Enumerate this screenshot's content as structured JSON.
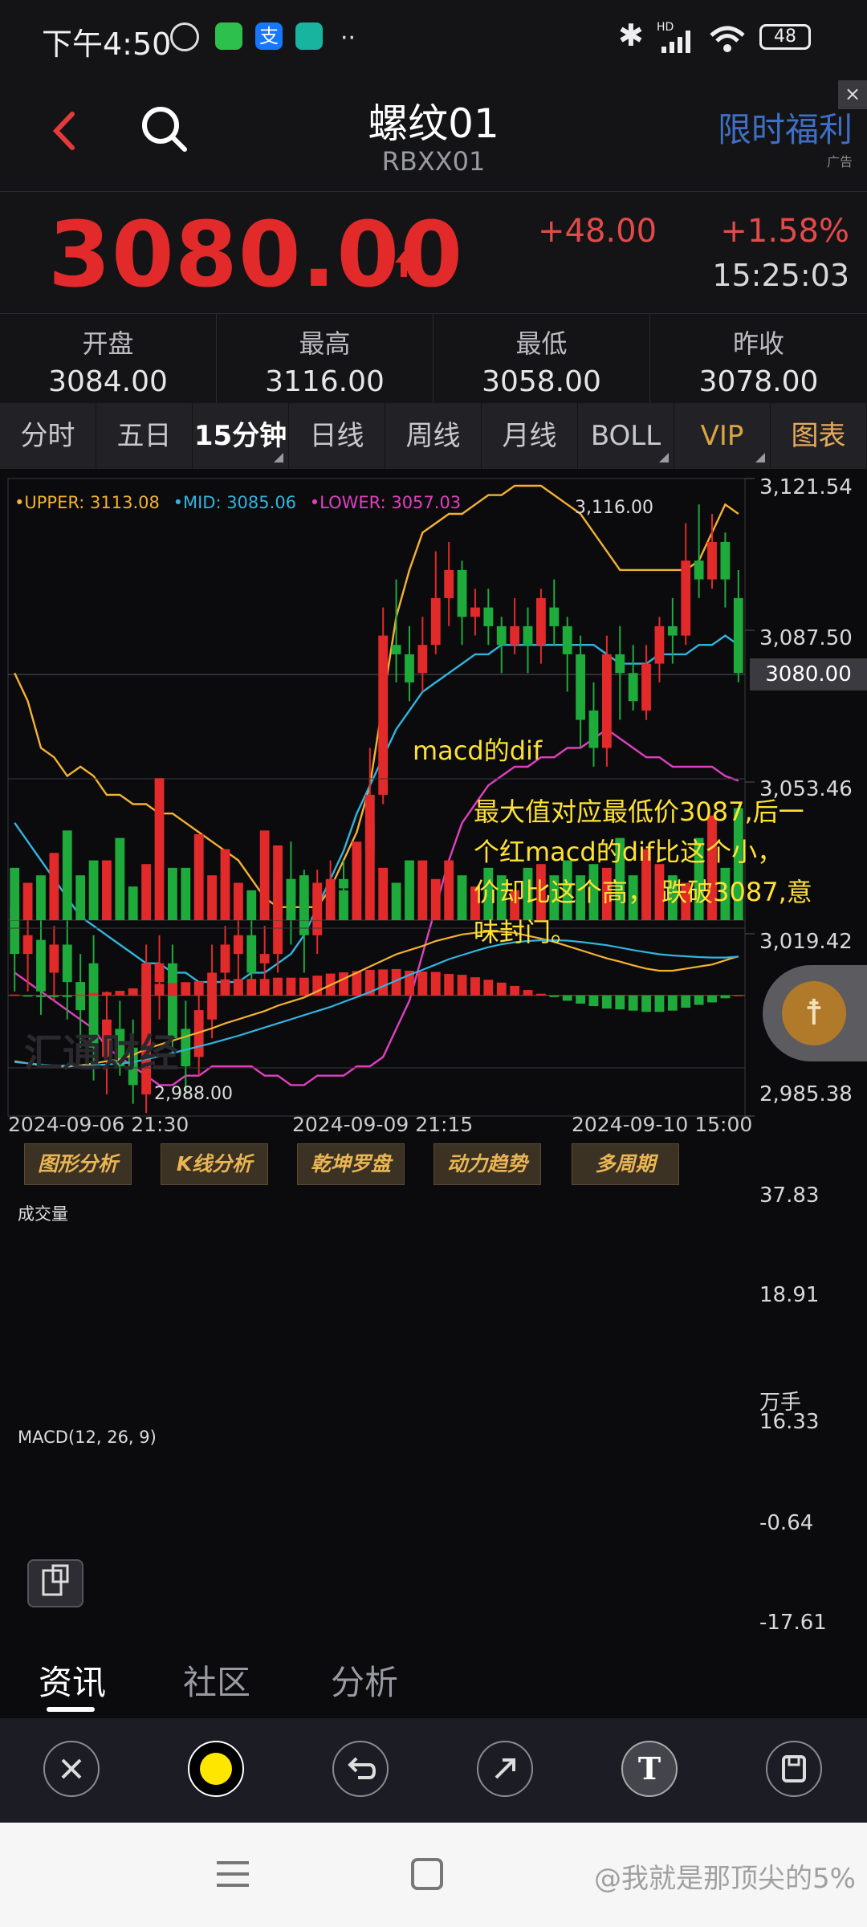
{
  "status_bar": {
    "time": "下午4:50",
    "hd_label": "HD",
    "battery": "48"
  },
  "header": {
    "title": "螺纹01",
    "code": "RBXX01",
    "promo": "限时福利",
    "ad_label": "广告",
    "close_icon": "close-icon"
  },
  "quote": {
    "price": "3080.00",
    "change": "+48.00",
    "change_pct": "+1.58%",
    "time": "15:25:03",
    "up_color": "#e32a2a"
  },
  "ohlc": [
    {
      "label": "开盘",
      "value": "3084.00"
    },
    {
      "label": "最高",
      "value": "3116.00"
    },
    {
      "label": "最低",
      "value": "3058.00"
    },
    {
      "label": "昨收",
      "value": "3078.00"
    }
  ],
  "tabs": [
    "分时",
    "五日",
    "15分钟",
    "日线",
    "周线",
    "月线",
    "BOLL",
    "VIP",
    "图表"
  ],
  "chart": {
    "legend": {
      "upper": "•UPPER: 3113.08",
      "mid": "•MID: 3085.06",
      "lower": "•LOWER: 3057.03"
    },
    "price_axis": [
      "3,121.54",
      "3,087.50",
      "3,053.46",
      "3,019.42",
      "2,985.38"
    ],
    "current_price_tag": "3080.00",
    "high_label": "3,116.00",
    "low_label": "2,988.00",
    "time_axis": [
      "2024-09-06 21:30",
      "2024-09-09 21:15",
      "2024-09-10 15:00"
    ],
    "annotation_title": "macd的dif",
    "annotation_lines": [
      "最大值对应最低价3087,后一",
      "个红macd的dif比这个小，",
      "价却比这个高， 跌破3087,意",
      "味封门。"
    ],
    "tool_buttons": [
      "图形分析",
      "K线分析",
      "乾坤罗盘",
      "动力趋势",
      "多周期"
    ],
    "volume_label": "成交量",
    "volume_axis": [
      "37.83",
      "18.91",
      "万手"
    ],
    "macd_label": "MACD(12, 26, 9)",
    "macd_axis": [
      "16.33",
      "-0.64",
      "-17.61"
    ],
    "watermark": "汇通财经"
  },
  "chart_data": {
    "type": "candlestick",
    "title": "螺纹01 15分钟",
    "xlabel": "",
    "ylabel": "",
    "ylim": [
      2985.38,
      3121.54
    ],
    "x_ticks": [
      "2024-09-06 21:30",
      "2024-09-09 21:15",
      "2024-09-10 15:00"
    ],
    "candles": [
      [
        3030,
        3020,
        3038,
        3012
      ],
      [
        3020,
        3024,
        3030,
        3012
      ],
      [
        3023,
        3012,
        3028,
        3007
      ],
      [
        3016,
        3022,
        3026,
        3010
      ],
      [
        3022,
        3014,
        3030,
        3006
      ],
      [
        3014,
        3008,
        3020,
        3000
      ],
      [
        3018,
        3000,
        3024,
        2993
      ],
      [
        2998,
        3006,
        3012,
        2990
      ],
      [
        3004,
        2996,
        3010,
        2994
      ],
      [
        3000,
        2992,
        3006,
        2988
      ],
      [
        2990,
        3018,
        3022,
        2986
      ],
      [
        3014,
        3018,
        3024,
        3006
      ],
      [
        3018,
        3002,
        3022,
        2998
      ],
      [
        3004,
        2996,
        3010,
        2990
      ],
      [
        2998,
        3008,
        3012,
        2994
      ],
      [
        3006,
        3016,
        3022,
        3002
      ],
      [
        3016,
        3022,
        3026,
        3012
      ],
      [
        3020,
        3024,
        3030,
        3014
      ],
      [
        3024,
        3016,
        3028,
        3012
      ],
      [
        3018,
        3020,
        3026,
        3014
      ],
      [
        3020,
        3036,
        3042,
        3016
      ],
      [
        3036,
        3032,
        3044,
        3022
      ],
      [
        3032,
        3024,
        3038,
        3016
      ],
      [
        3024,
        3034,
        3038,
        3020
      ],
      [
        3032,
        3036,
        3040,
        3030
      ],
      [
        3036,
        3034,
        3040,
        3028
      ],
      [
        3032,
        3042,
        3044,
        3030
      ],
      [
        3042,
        3054,
        3064,
        3040
      ],
      [
        3054,
        3088,
        3094,
        3052
      ],
      [
        3086,
        3084,
        3100,
        3078
      ],
      [
        3084,
        3078,
        3090,
        3074
      ],
      [
        3080,
        3086,
        3092,
        3076
      ],
      [
        3086,
        3096,
        3106,
        3084
      ],
      [
        3096,
        3102,
        3108,
        3090
      ],
      [
        3102,
        3092,
        3104,
        3086
      ],
      [
        3092,
        3094,
        3098,
        3088
      ],
      [
        3094,
        3090,
        3098,
        3086
      ],
      [
        3090,
        3086,
        3092,
        3080
      ],
      [
        3086,
        3090,
        3096,
        3084
      ],
      [
        3090,
        3086,
        3094,
        3080
      ],
      [
        3086,
        3096,
        3098,
        3082
      ],
      [
        3094,
        3090,
        3100,
        3086
      ],
      [
        3090,
        3084,
        3092,
        3076
      ],
      [
        3084,
        3070,
        3088,
        3064
      ],
      [
        3072,
        3064,
        3078,
        3060
      ],
      [
        3064,
        3084,
        3088,
        3060
      ],
      [
        3084,
        3080,
        3090,
        3070
      ],
      [
        3080,
        3074,
        3086,
        3072
      ],
      [
        3072,
        3082,
        3086,
        3070
      ],
      [
        3082,
        3090,
        3092,
        3078
      ],
      [
        3090,
        3088,
        3096,
        3082
      ],
      [
        3088,
        3104,
        3112,
        3086
      ],
      [
        3104,
        3100,
        3116,
        3096
      ],
      [
        3100,
        3108,
        3114,
        3098
      ],
      [
        3108,
        3100,
        3110,
        3094
      ],
      [
        3096,
        3080,
        3102,
        3078
      ]
    ],
    "series": [
      {
        "name": "UPPER",
        "color": "#f4b232",
        "values": [
          3080,
          3074,
          3064,
          3062,
          3058,
          3060,
          3058,
          3054,
          3054,
          3052,
          3052,
          3050,
          3050,
          3048,
          3046,
          3044,
          3042,
          3040,
          3036,
          3032,
          3030,
          3030,
          3030,
          3030,
          3034,
          3040,
          3046,
          3056,
          3074,
          3092,
          3102,
          3110,
          3112,
          3114,
          3114,
          3116,
          3118,
          3118,
          3120,
          3120,
          3120,
          3118,
          3116,
          3114,
          3110,
          3106,
          3102,
          3102,
          3102,
          3102,
          3102,
          3102,
          3104,
          3110,
          3116,
          3114
        ]
      },
      {
        "name": "MID",
        "color": "#32b4e0",
        "values": [
          3048,
          3044,
          3040,
          3036,
          3032,
          3028,
          3026,
          3024,
          3022,
          3020,
          3018,
          3018,
          3016,
          3016,
          3014,
          3014,
          3014,
          3014,
          3016,
          3016,
          3018,
          3020,
          3024,
          3030,
          3036,
          3042,
          3050,
          3056,
          3062,
          3068,
          3072,
          3076,
          3078,
          3080,
          3082,
          3084,
          3084,
          3086,
          3086,
          3086,
          3086,
          3086,
          3086,
          3086,
          3086,
          3084,
          3082,
          3082,
          3082,
          3084,
          3084,
          3084,
          3086,
          3086,
          3088,
          3086
        ]
      },
      {
        "name": "LOWER",
        "color": "#e040c0",
        "values": [
          3016,
          3014,
          3012,
          3010,
          3008,
          3006,
          3004,
          3000,
          2998,
          2996,
          2994,
          2992,
          2992,
          2994,
          2994,
          2996,
          2996,
          2996,
          2996,
          2994,
          2994,
          2992,
          2992,
          2994,
          2994,
          2994,
          2996,
          2996,
          2998,
          3004,
          3010,
          3020,
          3030,
          3040,
          3048,
          3052,
          3056,
          3058,
          3060,
          3060,
          3062,
          3062,
          3064,
          3064,
          3066,
          3068,
          3066,
          3064,
          3062,
          3062,
          3060,
          3060,
          3060,
          3060,
          3058,
          3057
        ]
      }
    ],
    "volume": [
      14,
      10,
      12,
      18,
      24,
      12,
      16,
      16,
      22,
      9,
      15,
      38,
      14,
      14,
      23,
      12,
      19,
      10,
      8,
      24,
      20,
      11,
      12,
      10,
      9,
      8,
      21,
      26,
      14,
      10,
      16,
      16,
      11,
      16,
      12,
      9,
      14,
      12,
      8,
      14,
      15,
      12,
      16,
      12,
      15,
      14,
      22,
      12,
      19,
      15,
      12,
      10,
      22,
      28,
      14,
      30
    ],
    "macd": {
      "dif": [
        -16,
        -16.5,
        -17,
        -17.2,
        -17.3,
        -17,
        -16.5,
        -16,
        -15.5,
        -14.5,
        -13,
        -12,
        -11,
        -10,
        -9,
        -8,
        -6.8,
        -5.8,
        -4.8,
        -3.8,
        -2.5,
        -1.5,
        -0.5,
        1,
        2.5,
        4,
        5.5,
        7,
        8.5,
        10,
        11,
        12,
        13.2,
        14,
        14.8,
        15.2,
        15.5,
        15.5,
        15.2,
        14.5,
        13.8,
        13,
        12,
        11,
        10,
        9,
        8.2,
        7.3,
        6.5,
        6,
        6,
        6.5,
        7,
        7.5,
        8.5,
        9.5
      ],
      "dea": [
        -16.2,
        -16.5,
        -16.8,
        -17,
        -17.1,
        -17.1,
        -17,
        -16.8,
        -16.6,
        -16.2,
        -15.5,
        -14.8,
        -14,
        -13.2,
        -12.4,
        -11.6,
        -10.7,
        -9.8,
        -8.8,
        -7.8,
        -6.8,
        -5.8,
        -4.8,
        -3.8,
        -2.8,
        -1.6,
        -0.4,
        0.8,
        2.2,
        3.6,
        5,
        6.2,
        7.5,
        8.8,
        9.8,
        10.8,
        11.7,
        12.4,
        12.9,
        13.2,
        13.4,
        13.4,
        13.3,
        13,
        12.6,
        12.2,
        11.6,
        11,
        10.5,
        10,
        9.7,
        9.5,
        9.3,
        9.2,
        9.2,
        9.4
      ],
      "hist": [
        0.2,
        -0.3,
        -0.4,
        -0.4,
        -0.4,
        0.2,
        0.6,
        0.8,
        1.1,
        1.7,
        2.5,
        2.8,
        3,
        3.2,
        3.4,
        3.6,
        3.9,
        4,
        4,
        4,
        4.3,
        4.3,
        4.3,
        4.8,
        5.3,
        5.6,
        5.9,
        6.2,
        6.3,
        6.4,
        6,
        5.8,
        5.7,
        5.2,
        5,
        4.4,
        3.8,
        3.1,
        2.3,
        1.3,
        0.4,
        -0.4,
        -1.3,
        -2,
        -2.6,
        -3.2,
        -3.4,
        -3.7,
        -4,
        -4,
        -3.7,
        -3,
        -2.3,
        -1.7,
        -0.7,
        0.1
      ]
    }
  },
  "news_tabs": [
    "资讯",
    "社区",
    "分析"
  ],
  "toolbar_icons": [
    "close-icon",
    "color-dot-icon",
    "undo-icon",
    "arrow-icon",
    "text-icon",
    "save-icon"
  ],
  "watermark": "@我就是那顶尖的5%"
}
